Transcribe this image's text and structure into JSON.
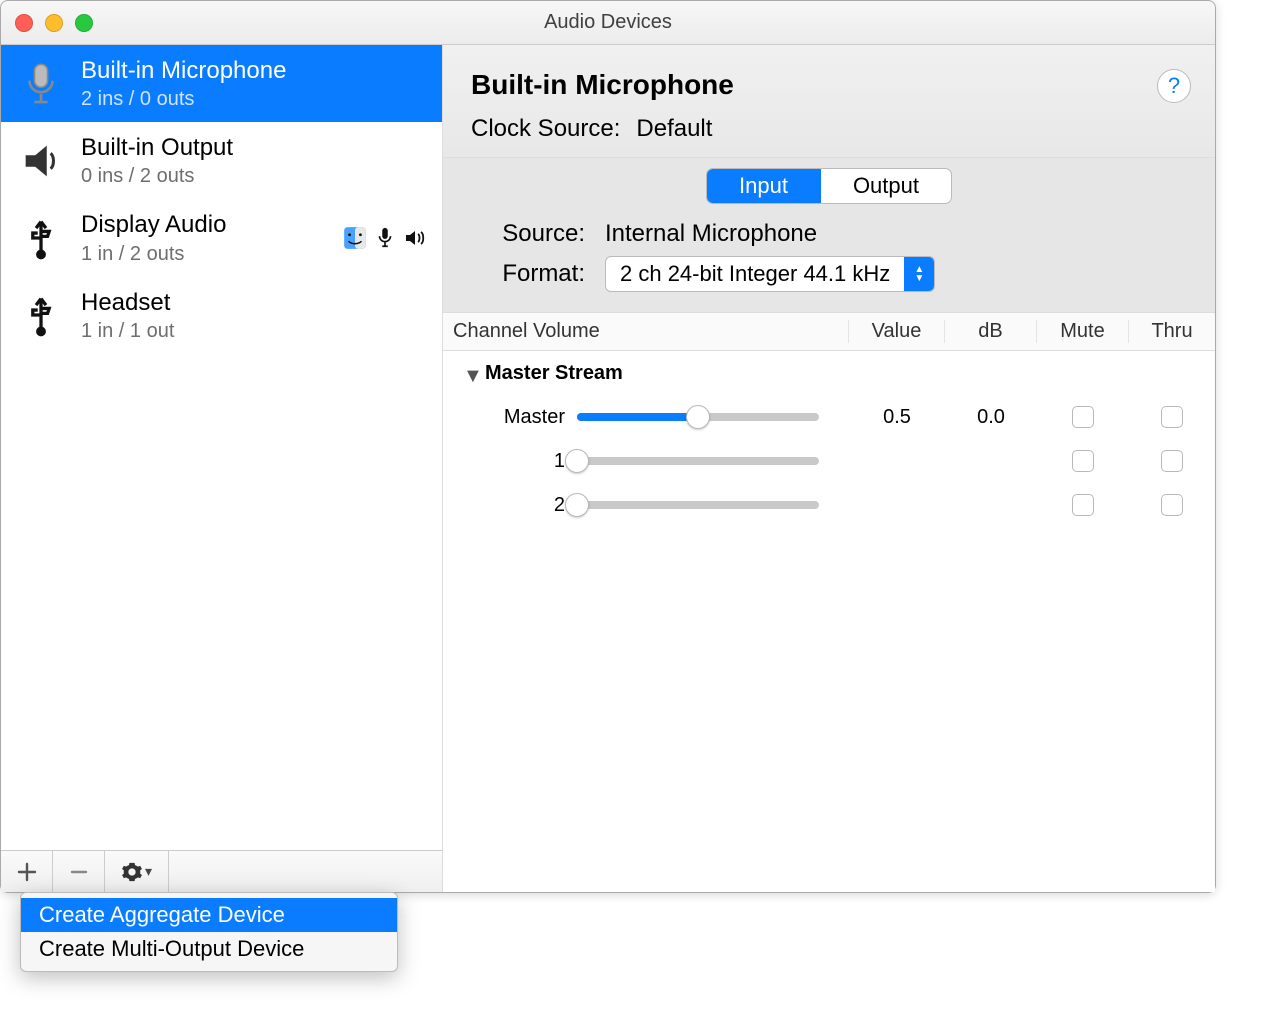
{
  "window": {
    "title": "Audio Devices"
  },
  "sidebar": {
    "devices": [
      {
        "name": "Built-in Microphone",
        "sub": "2 ins / 0 outs",
        "icon": "mic",
        "selected": true,
        "flags": []
      },
      {
        "name": "Built-in Output",
        "sub": "0 ins / 2 outs",
        "icon": "speaker",
        "selected": false,
        "flags": []
      },
      {
        "name": "Display Audio",
        "sub": "1 in / 2 outs",
        "icon": "usb",
        "selected": false,
        "flags": [
          "finder",
          "mic",
          "sound"
        ]
      },
      {
        "name": "Headset",
        "sub": "1 in / 1 out",
        "icon": "usb",
        "selected": false,
        "flags": []
      }
    ],
    "footer_buttons": [
      "plus",
      "minus",
      "gear"
    ]
  },
  "popup": {
    "items": [
      {
        "label": "Create Aggregate Device",
        "highlighted": true
      },
      {
        "label": "Create Multi-Output Device",
        "highlighted": false
      }
    ]
  },
  "detail": {
    "title": "Built-in Microphone",
    "clock_label": "Clock Source:",
    "clock_value": "Default",
    "tabs": {
      "input": "Input",
      "output": "Output",
      "active": "input"
    },
    "source_label": "Source:",
    "source_value": "Internal Microphone",
    "format_label": "Format:",
    "format_value": "2 ch 24-bit Integer 44.1 kHz",
    "columns": {
      "name": "Channel Volume",
      "value": "Value",
      "db": "dB",
      "mute": "Mute",
      "thru": "Thru"
    },
    "stream_label": "Master Stream",
    "channels": [
      {
        "name": "Master",
        "value": "0.5",
        "db": "0.0",
        "slider": 0.5,
        "enabled": true,
        "mute": false,
        "thru": false
      },
      {
        "name": "1",
        "value": "",
        "db": "",
        "slider": 0.0,
        "enabled": false,
        "mute": false,
        "thru": false
      },
      {
        "name": "2",
        "value": "",
        "db": "",
        "slider": 0.0,
        "enabled": false,
        "mute": false,
        "thru": false
      }
    ]
  }
}
